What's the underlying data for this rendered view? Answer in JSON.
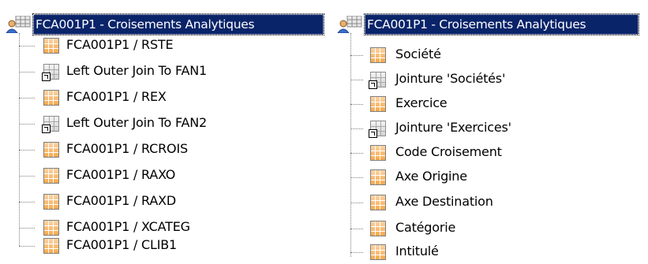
{
  "left_tree": {
    "title": "FCA001P1 - Croisements Analytiques",
    "items": [
      {
        "label": "FCA001P1 / RSTE",
        "icon": "table-icon"
      },
      {
        "label": "Left Outer Join To FAN1",
        "icon": "join-icon"
      },
      {
        "label": "FCA001P1 / REX",
        "icon": "table-icon"
      },
      {
        "label": "Left Outer Join To FAN2",
        "icon": "join-icon"
      },
      {
        "label": "FCA001P1 / RCROIS",
        "icon": "table-icon"
      },
      {
        "label": "FCA001P1 / RAXO",
        "icon": "table-icon"
      },
      {
        "label": "FCA001P1 / RAXD",
        "icon": "table-icon"
      },
      {
        "label": "FCA001P1 / XCATEG",
        "icon": "table-icon"
      },
      {
        "label": "FCA001P1 / CLIB1",
        "icon": "table-icon"
      }
    ]
  },
  "right_tree": {
    "title": "FCA001P1 - Croisements Analytiques",
    "items": [
      {
        "label": "Société",
        "icon": "table-icon"
      },
      {
        "label": "Jointure 'Sociétés'",
        "icon": "join-icon"
      },
      {
        "label": "Exercice",
        "icon": "table-icon"
      },
      {
        "label": "Jointure 'Exercices'",
        "icon": "join-icon"
      },
      {
        "label": "Code Croisement",
        "icon": "table-icon"
      },
      {
        "label": "Axe Origine",
        "icon": "table-icon"
      },
      {
        "label": "Axe Destination",
        "icon": "table-icon"
      },
      {
        "label": "Catégorie",
        "icon": "table-icon"
      },
      {
        "label": "Intitulé",
        "icon": "table-icon"
      }
    ]
  },
  "colors": {
    "selection": "#0a246a",
    "table_icon": "#f7a94c",
    "connector": "#808080"
  }
}
